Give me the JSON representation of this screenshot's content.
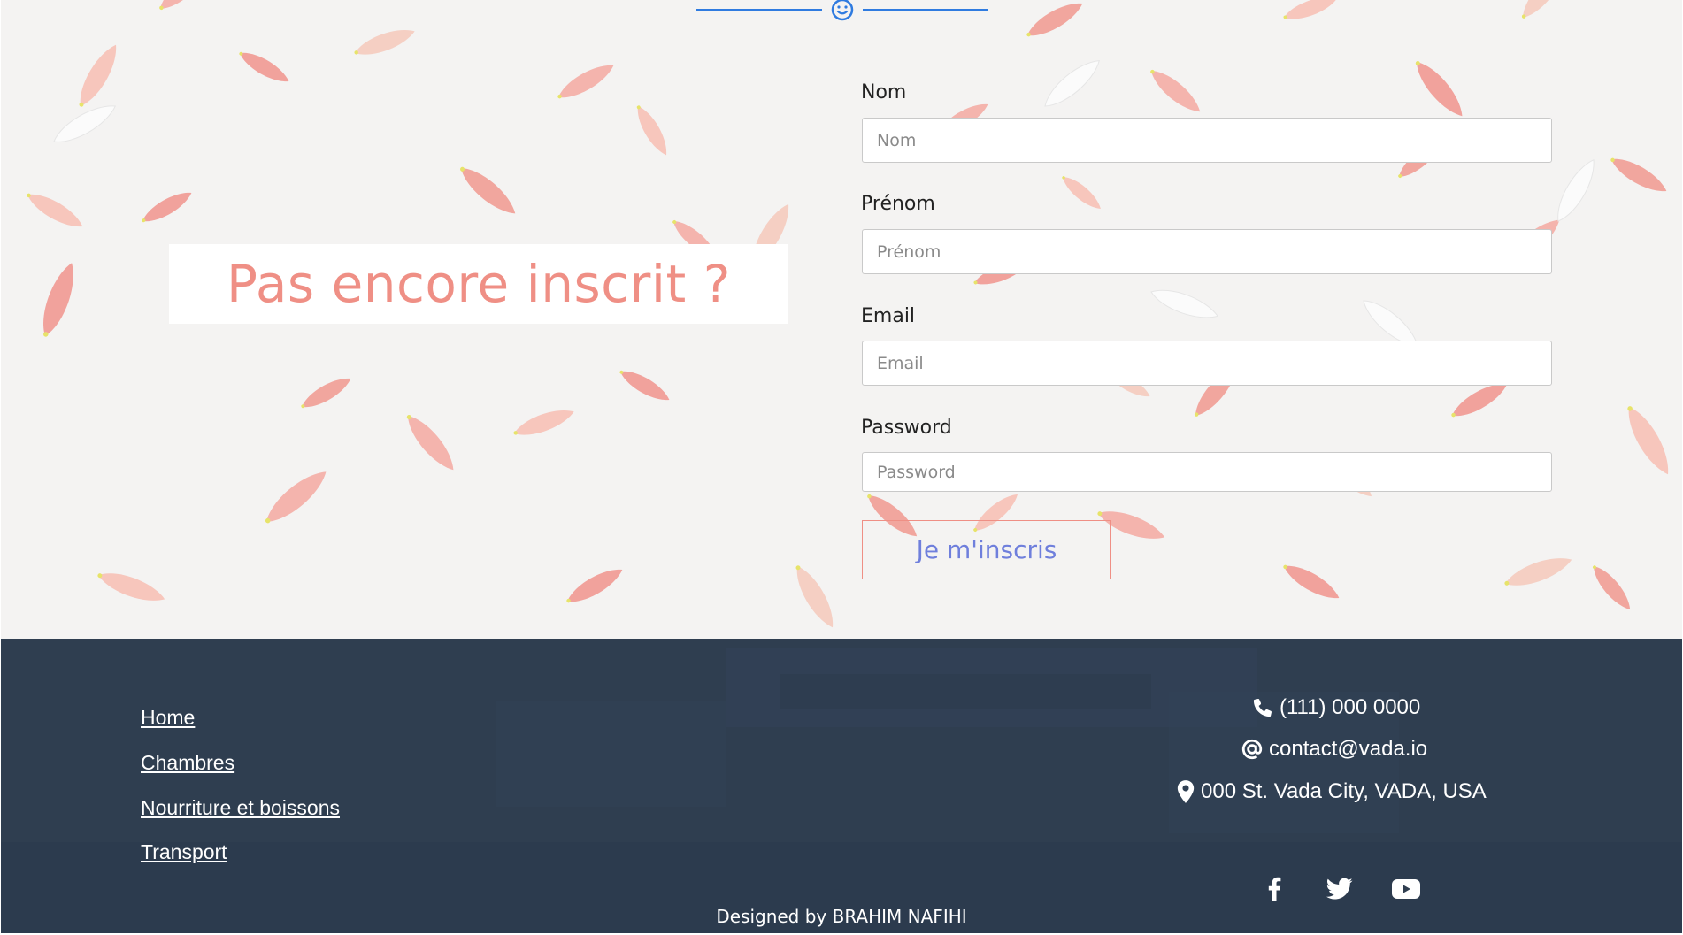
{
  "signup": {
    "heading": "Pas encore inscrit ?",
    "fields": [
      {
        "label": "Nom",
        "placeholder": "Nom"
      },
      {
        "label": "Prénom",
        "placeholder": "Prénom"
      },
      {
        "label": "Email",
        "placeholder": "Email"
      },
      {
        "label": "Password",
        "placeholder": "Password"
      }
    ],
    "submit_label": "Je m'inscris"
  },
  "footer": {
    "links": [
      "Home",
      "Chambres",
      "Nourriture et boissons",
      "Transport"
    ],
    "contact": {
      "phone": "(111) 000 0000",
      "email": "contact@vada.io",
      "address": "000 St. Vada City, VADA, USA"
    },
    "social": [
      "facebook-icon",
      "twitter-icon",
      "youtube-icon"
    ],
    "credit": "Designed by BRAHIM NAFIHI"
  },
  "colors": {
    "accent_pink": "#ef8f85",
    "button_text": "#6f7fdc",
    "footer_bg": "#2f3e50",
    "divider_blue": "#2f7be0"
  }
}
